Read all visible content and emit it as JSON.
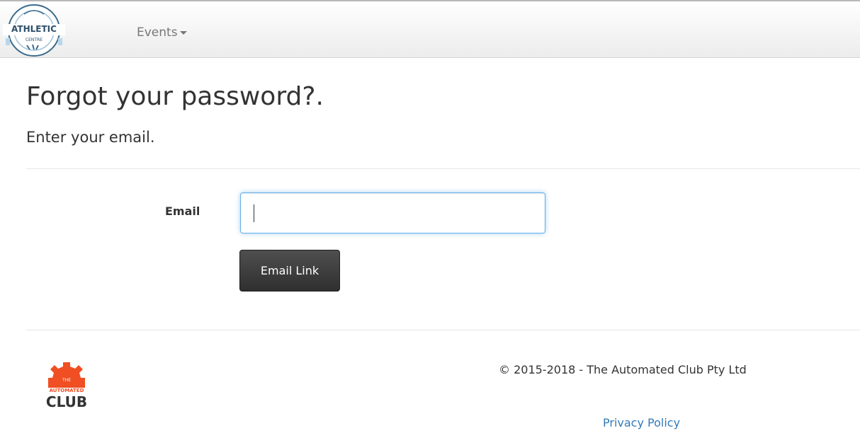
{
  "navbar": {
    "brand_logo": {
      "ring_text": "ATHLETIC",
      "sub_text": "CENTRE"
    },
    "events_label": "Events"
  },
  "main": {
    "title": "Forgot your password?.",
    "subtitle": "Enter your email.",
    "form": {
      "email_label": "Email",
      "email_value": "",
      "email_placeholder": "",
      "submit_label": "Email Link"
    }
  },
  "footer": {
    "logo": {
      "line1": "THE",
      "line2": "AUTOMATED",
      "line3": "CLUB"
    },
    "copyright": "© 2015-2018 - The Automated Club Pty Ltd",
    "privacy_label": "Privacy Policy"
  },
  "colors": {
    "link": "#337ab7",
    "button": "#333333",
    "focus_border": "#66afe9",
    "brand_orange": "#f04e23"
  }
}
